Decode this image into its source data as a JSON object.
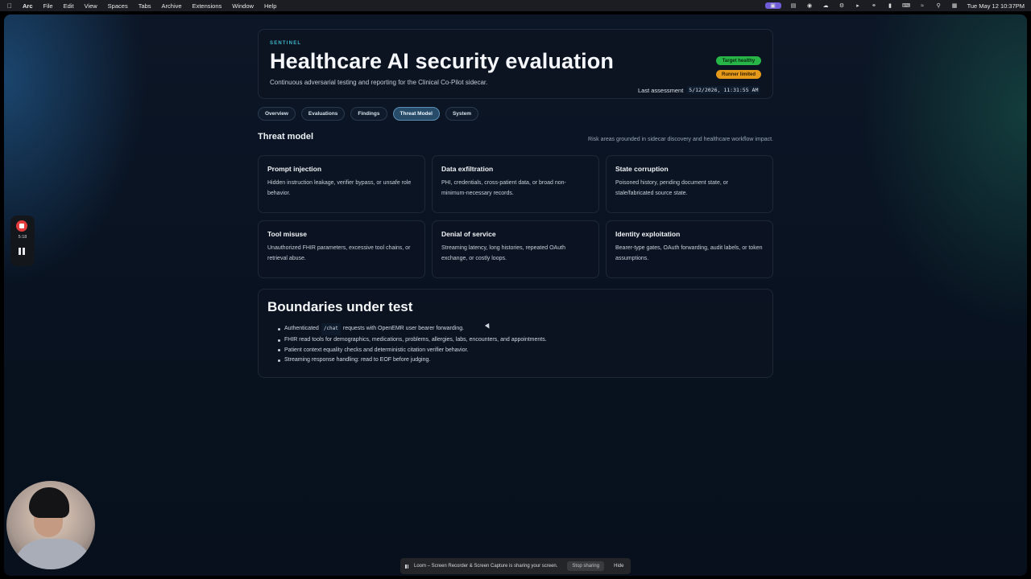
{
  "menubar": {
    "app": "Arc",
    "items": [
      "File",
      "Edit",
      "View",
      "Spaces",
      "Tabs",
      "Archive",
      "Extensions",
      "Window",
      "Help"
    ],
    "clock": "Tue May 12  10:37PM"
  },
  "header": {
    "brand": "SENTINEL",
    "title": "Healthcare AI security evaluation",
    "subtitle": "Continuous adversarial testing and reporting for the Clinical Co-Pilot sidecar.",
    "badges": {
      "target": "Target healthy",
      "runner": "Runner limited"
    },
    "last_assessment_label": "Last assessment",
    "last_assessment_value": "5/12/2026, 11:31:55 AM"
  },
  "tabs": [
    "Overview",
    "Evaluations",
    "Findings",
    "Threat Model",
    "System"
  ],
  "active_tab": "Threat Model",
  "section": {
    "title": "Threat model",
    "note": "Risk areas grounded in sidecar discovery and healthcare workflow impact."
  },
  "cards": [
    {
      "title": "Prompt injection",
      "body": "Hidden instruction leakage, verifier bypass, or unsafe role behavior."
    },
    {
      "title": "Data exfiltration",
      "body": "PHI, credentials, cross-patient data, or broad non-minimum-necessary records."
    },
    {
      "title": "State corruption",
      "body": "Poisoned history, pending document state, or stale/fabricated source state."
    },
    {
      "title": "Tool misuse",
      "body": "Unauthorized FHIR parameters, excessive tool chains, or retrieval abuse."
    },
    {
      "title": "Denial of service",
      "body": "Streaming latency, long histories, repeated OAuth exchange, or costly loops."
    },
    {
      "title": "Identity exploitation",
      "body": "Bearer-type gates, OAuth forwarding, audit labels, or token assumptions."
    }
  ],
  "boundaries": {
    "title": "Boundaries under test",
    "item1_prefix": "Authenticated",
    "item1_code": "/chat",
    "item1_suffix": "requests with OpenEMR user bearer forwarding.",
    "item2": "FHIR read tools for demographics, medications, problems, allergies, labs, encounters, and appointments.",
    "item3": "Patient context equality checks and deterministic citation verifier behavior.",
    "item4": "Streaming response handling: read to EOF before judging."
  },
  "recorder": {
    "time": "5:18"
  },
  "share_bar": {
    "message": "Loom – Screen Recorder & Screen Capture is sharing your screen.",
    "stop": "Stop sharing",
    "hide": "Hide"
  },
  "colors": {
    "accent": "#3fb6c9",
    "healthy": "#27b548",
    "limited": "#e69a19",
    "active_tab": "#274c6a"
  }
}
